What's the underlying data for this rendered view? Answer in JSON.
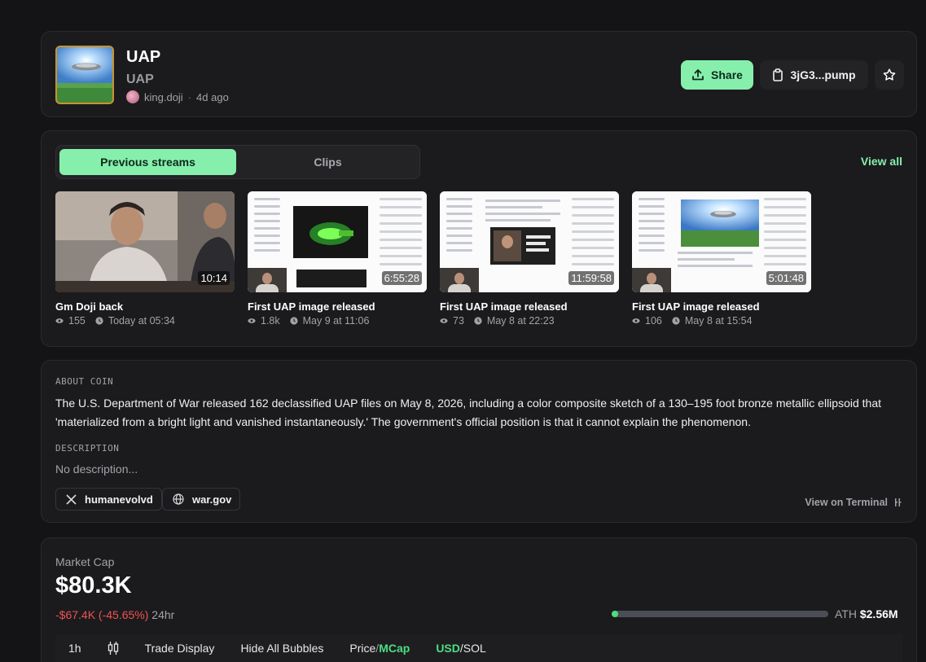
{
  "header": {
    "name": "UAP",
    "ticker": "UAP",
    "creator": "king.doji",
    "age": "4d ago",
    "share_label": "Share",
    "contract_label": "3jG3...pump"
  },
  "streams": {
    "tabs": [
      "Previous streams",
      "Clips"
    ],
    "view_all": "View all",
    "clips": [
      {
        "title": "Gm Doji back",
        "duration": "10:14",
        "views": "155",
        "time": "Today at 05:34"
      },
      {
        "title": "First UAP image released",
        "duration": "6:55:28",
        "views": "1.8k",
        "time": "May 9 at 11:06"
      },
      {
        "title": "First UAP image released",
        "duration": "11:59:58",
        "views": "73",
        "time": "May 8 at 22:23"
      },
      {
        "title": "First UAP image released",
        "duration": "5:01:48",
        "views": "106",
        "time": "May 8 at 15:54"
      }
    ]
  },
  "about": {
    "label": "ABOUT COIN",
    "text": "The U.S. Department of War released 162 declassified UAP files on May 8, 2026, including a color composite sketch of a 130–195 foot bronze metallic ellipsoid that 'materialized from a bright light and vanished instantaneously.' The government's official position is that it cannot explain the phenomenon.",
    "desc_label": "DESCRIPTION",
    "desc_text": "No description...",
    "links": [
      "humanevolvd",
      "war.gov"
    ],
    "view_terminal": "View on Terminal"
  },
  "market": {
    "label": "Market Cap",
    "value": "$80.3K",
    "change": "-$67.4K (-45.65%)",
    "period": "24hr",
    "ath_label": "ATH",
    "ath_value": "$2.56M",
    "ath_progress": 0.031,
    "toolbar": {
      "interval": "1h",
      "trade_display": "Trade Display",
      "hide_bubbles": "Hide All Bubbles",
      "price": "Price",
      "mcap": "MCap",
      "usd": "USD",
      "sol": "SOL"
    }
  },
  "colors": {
    "accent": "#86efac",
    "negative": "#ef5350",
    "ath_fill": "#4ade80"
  }
}
